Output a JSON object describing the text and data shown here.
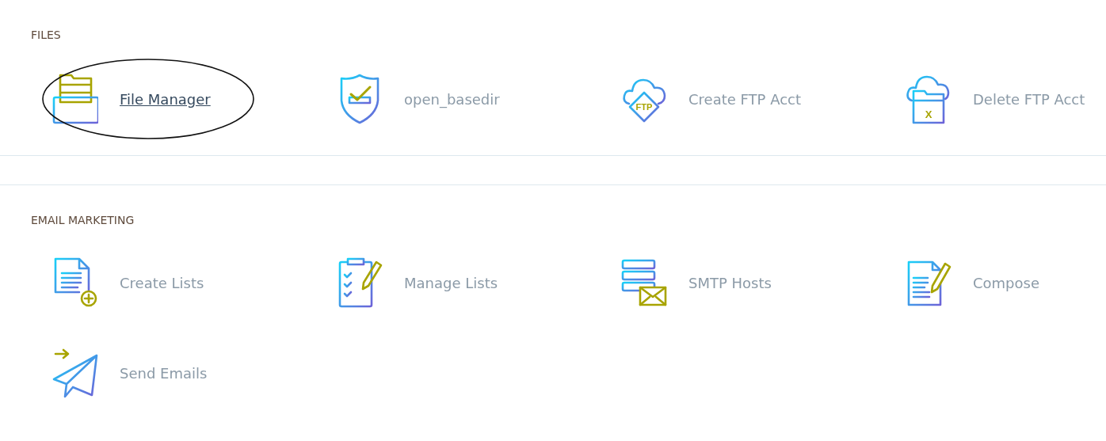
{
  "sections": [
    {
      "title": "FILES",
      "items": [
        {
          "label": "File Manager",
          "kind": "drawer",
          "selected": true,
          "circled": true
        },
        {
          "label": "open_basedir",
          "kind": "shield",
          "selected": false,
          "circled": false
        },
        {
          "label": "Create FTP Acct",
          "kind": "cloud-ftp",
          "icon_text": "FTP",
          "selected": false,
          "circled": false
        },
        {
          "label": "Delete FTP Acct",
          "kind": "cloud-folder",
          "icon_text": "X",
          "selected": false,
          "circled": false
        }
      ]
    },
    {
      "title": "EMAIL MARKETING",
      "items": [
        {
          "label": "Create Lists",
          "kind": "doc-plus",
          "selected": false,
          "circled": false
        },
        {
          "label": "Manage Lists",
          "kind": "clipboard",
          "selected": false,
          "circled": false
        },
        {
          "label": "SMTP Hosts",
          "kind": "server-mail",
          "selected": false,
          "circled": false
        },
        {
          "label": "Compose",
          "kind": "doc-pencil",
          "selected": false,
          "circled": false
        },
        {
          "label": "Send Emails",
          "kind": "plane",
          "selected": false,
          "circled": false
        }
      ]
    }
  ]
}
